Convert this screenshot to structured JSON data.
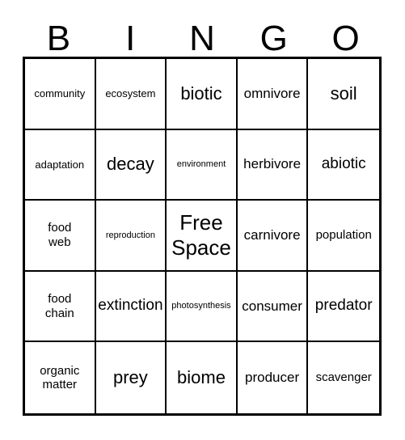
{
  "header": {
    "letters": [
      "B",
      "I",
      "N",
      "G",
      "O"
    ]
  },
  "grid": {
    "cells": [
      {
        "label": "community",
        "size": "s-sm"
      },
      {
        "label": "ecosystem",
        "size": "s-sm"
      },
      {
        "label": "biotic",
        "size": "s-xxl"
      },
      {
        "label": "omnivore",
        "size": "s-lg"
      },
      {
        "label": "soil",
        "size": "s-xxl"
      },
      {
        "label": "adaptation",
        "size": "s-sm"
      },
      {
        "label": "decay",
        "size": "s-xxl"
      },
      {
        "label": "environment",
        "size": "s-xs"
      },
      {
        "label": "herbivore",
        "size": "s-lg"
      },
      {
        "label": "abiotic",
        "size": "s-xl"
      },
      {
        "label": "food\nweb",
        "size": "s-md"
      },
      {
        "label": "reproduction",
        "size": "s-xs"
      },
      {
        "label": "Free\nSpace",
        "size": "s-free"
      },
      {
        "label": "carnivore",
        "size": "s-lg"
      },
      {
        "label": "population",
        "size": "s-md"
      },
      {
        "label": "food\nchain",
        "size": "s-md"
      },
      {
        "label": "extinction",
        "size": "s-xl"
      },
      {
        "label": "photosynthesis",
        "size": "s-xs"
      },
      {
        "label": "consumer",
        "size": "s-lg"
      },
      {
        "label": "predator",
        "size": "s-xl"
      },
      {
        "label": "organic\nmatter",
        "size": "s-md"
      },
      {
        "label": "prey",
        "size": "s-xxl"
      },
      {
        "label": "biome",
        "size": "s-xxl"
      },
      {
        "label": "producer",
        "size": "s-lg"
      },
      {
        "label": "scavenger",
        "size": "s-md"
      }
    ]
  },
  "colors": {
    "ink": "#000000",
    "paper": "#ffffff"
  }
}
